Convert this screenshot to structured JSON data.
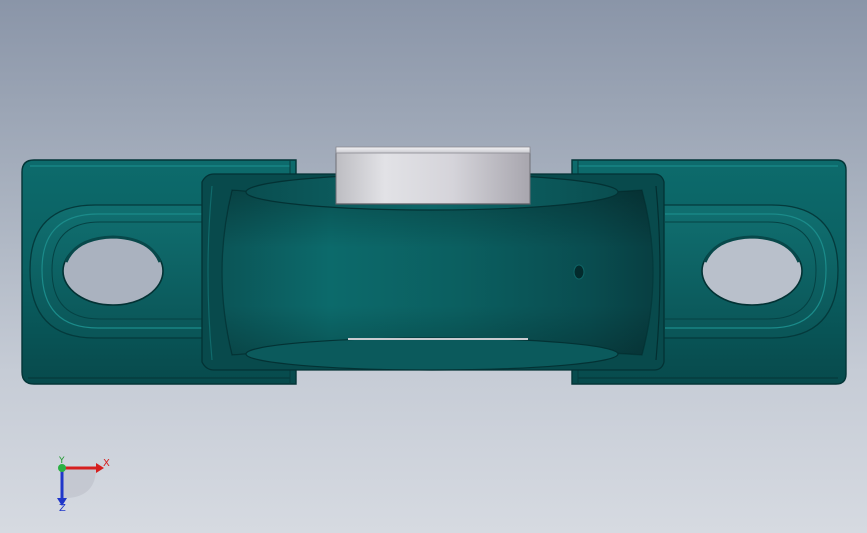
{
  "viewport": {
    "background_top": "#8a95a8",
    "background_bottom": "#d6dae1"
  },
  "model": {
    "part": "pillow-block-bearing",
    "housing_color": "#0a5a5c",
    "insert_color": "#d7d7db"
  },
  "triad": {
    "x_label": "X",
    "y_label": "Y",
    "z_label": "Z",
    "x_color": "#d61f1f",
    "y_color": "#1e9a2e",
    "z_color": "#1f36c9"
  }
}
